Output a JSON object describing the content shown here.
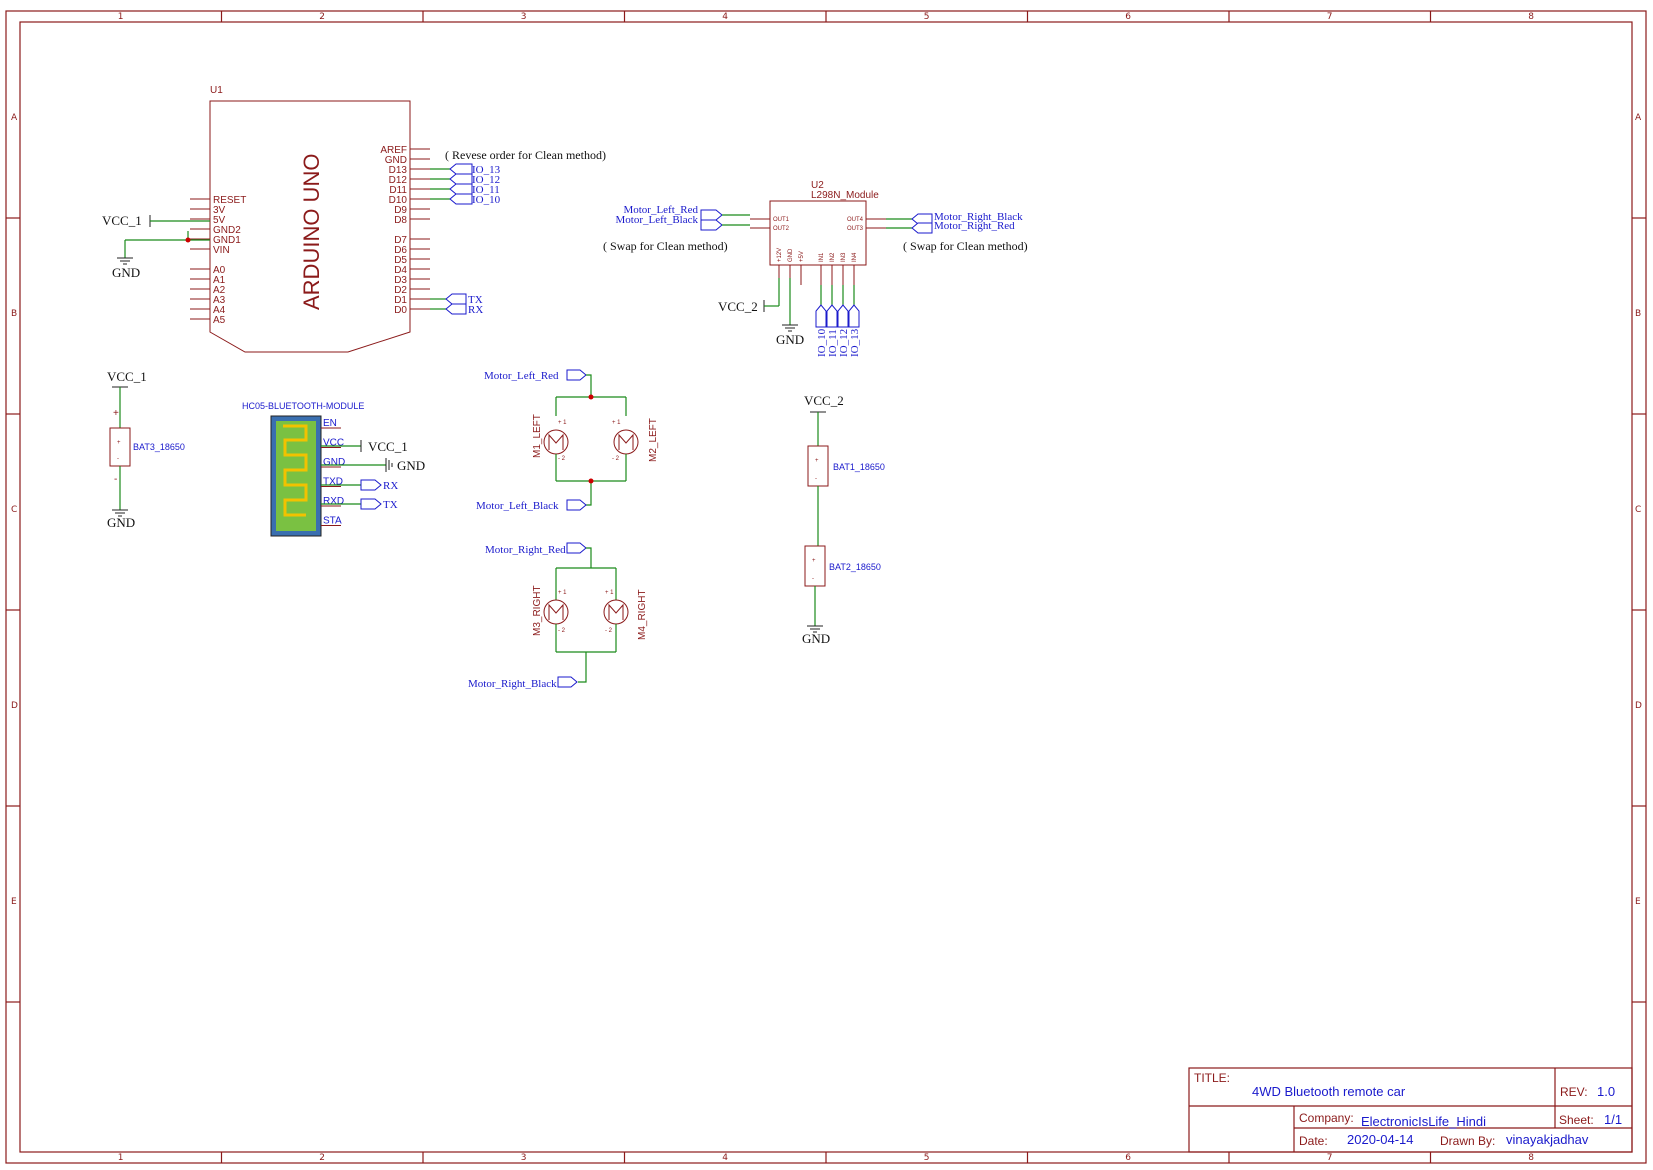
{
  "frame": {
    "columns": [
      "1",
      "2",
      "3",
      "4",
      "5",
      "6",
      "7",
      "8"
    ],
    "rows": [
      "A",
      "B",
      "C",
      "D",
      "E"
    ]
  },
  "arduino": {
    "ref": "U1",
    "name": "ARDUINO UNO",
    "left_pins": [
      "RESET",
      "3V",
      "5V",
      "GND2",
      "GND1",
      "VIN",
      "A0",
      "A1",
      "A2",
      "A3",
      "A4",
      "A5"
    ],
    "right_pins": [
      "AREF",
      "GND",
      "D13",
      "D12",
      "D11",
      "D10",
      "D9",
      "D8",
      "D7",
      "D6",
      "D5",
      "D4",
      "D3",
      "D2",
      "D1",
      "D0"
    ],
    "note": "( Revese order for Clean method)",
    "io_nets": [
      "IO_13",
      "IO_12",
      "IO_11",
      "IO_10"
    ],
    "serial_nets": [
      "TX",
      "RX"
    ],
    "vcc": "VCC_1",
    "gnd": "GND"
  },
  "l298n": {
    "ref": "U2",
    "name": "L298N_Module",
    "left_pins": [
      "OUT1",
      "OUT2"
    ],
    "right_pins": [
      "OUT4",
      "OUT3"
    ],
    "bottom_pins": [
      "+12V",
      "GND",
      "+5V",
      "IN1",
      "IN2",
      "IN3",
      "IN4"
    ],
    "left_nets": [
      "Motor_Left_Red",
      "Motor_Left_Black"
    ],
    "right_nets": [
      "Motor_Right_Black",
      "Motor_Right_Red"
    ],
    "left_note": "( Swap for Clean method)",
    "right_note": "( Swap for Clean method)",
    "io_nets": [
      "IO_10",
      "IO_11",
      "IO_12",
      "IO_13"
    ],
    "vcc": "VCC_2",
    "gnd": "GND"
  },
  "bat3": {
    "ref": "BAT3_18650",
    "vcc": "VCC_1",
    "gnd": "GND",
    "plus": "+",
    "minus": "-"
  },
  "bluetooth": {
    "title": "HC05-BLUETOOTH-MODULE",
    "pins": [
      "EN",
      "VCC",
      "GND",
      "TXD",
      "RXD",
      "STA"
    ],
    "vcc": "VCC_1",
    "gnd": "GND",
    "rx_net": "RX",
    "tx_net": "TX"
  },
  "motors_left": {
    "top_net": "Motor_Left_Red",
    "bottom_net": "Motor_Left_Black",
    "m1": "M1_LEFT",
    "m2": "M2_LEFT"
  },
  "motors_right": {
    "top_net": "Motor_Right_Red",
    "bottom_net": "Motor_Right_Black",
    "m3": "M3_RIGHT",
    "m4": "M4_RIGHT"
  },
  "batteries_right": {
    "vcc": "VCC_2",
    "bat1": "BAT1_18650",
    "bat2": "BAT2_18650",
    "gnd": "GND"
  },
  "title_block": {
    "title_key": "TITLE:",
    "title": "4WD Bluetooth remote car",
    "rev_key": "REV:",
    "rev": "1.0",
    "company_key": "Company:",
    "company": "ElectronicIsLife_Hindi",
    "sheet_key": "Sheet:",
    "sheet": "1/1",
    "date_key": "Date:",
    "date": "2020-04-14",
    "drawn_key": "Drawn By:",
    "drawn": "vinayakjadhav"
  }
}
